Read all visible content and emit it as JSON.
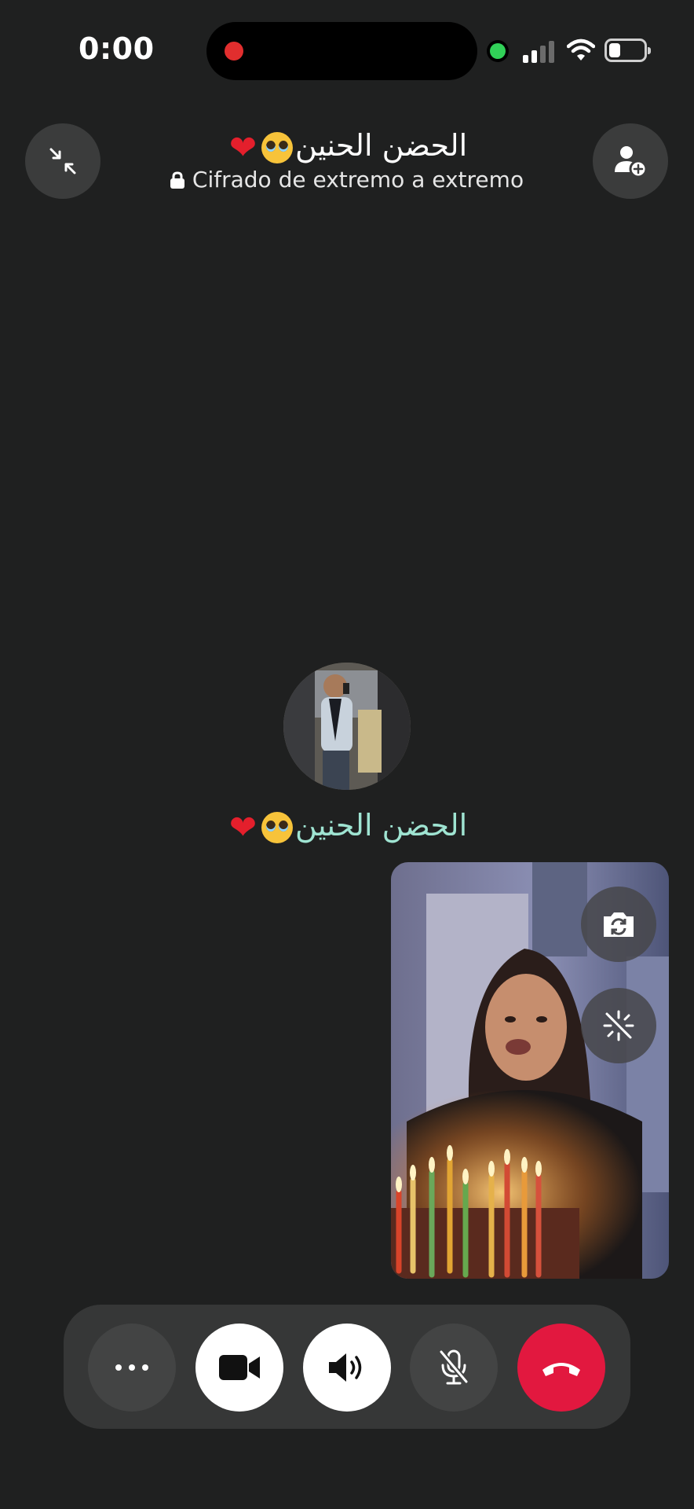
{
  "status_bar": {
    "time": "0:00"
  },
  "header": {
    "contact_name": "الحضن الحنين",
    "encryption_label": "Cifrado de extremo a extremo",
    "minimize_icon": "collapse-arrows-icon",
    "add_person_icon": "add-person-icon"
  },
  "remote": {
    "name": "الحضن الحنين",
    "name_color": "#9fe4d2"
  },
  "self_preview": {
    "flip_icon": "camera-flip-icon",
    "effects_icon": "effects-off-icon"
  },
  "controls": {
    "more_icon": "more-icon",
    "video_icon": "video-camera-icon",
    "speaker_icon": "speaker-icon",
    "mute_icon": "mic-off-icon",
    "end_icon": "end-call-icon",
    "end_color": "#e2183f"
  }
}
